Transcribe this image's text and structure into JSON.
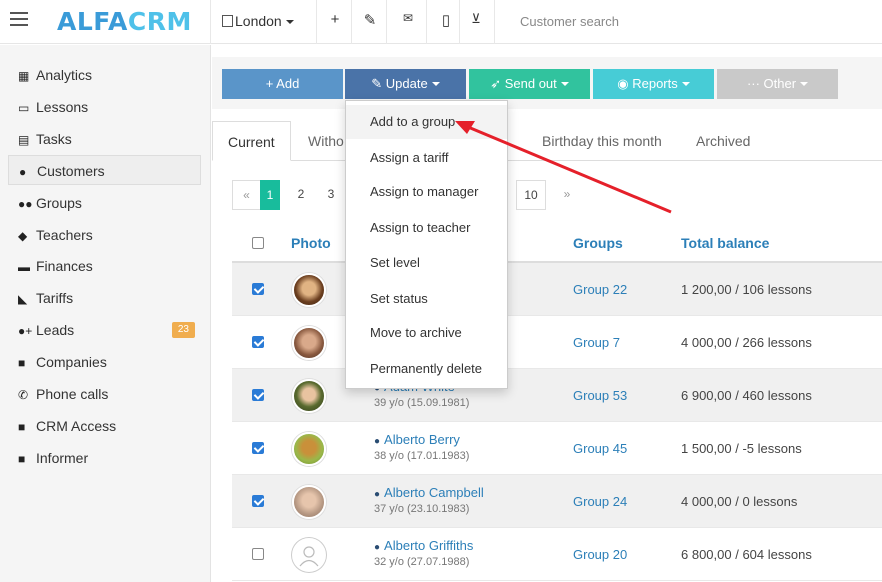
{
  "topbar": {
    "logo_part1": "ALFA",
    "logo_part2": "CRM",
    "branch": "London",
    "search_placeholder": "Customer search"
  },
  "sidebar": {
    "items": [
      {
        "label": "Analytics",
        "icon": "analytics-icon",
        "glyph": "▦"
      },
      {
        "label": "Lessons",
        "icon": "calendar-icon",
        "glyph": "▭"
      },
      {
        "label": "Tasks",
        "icon": "tasks-icon",
        "glyph": "▤"
      },
      {
        "label": "Customers",
        "icon": "user-icon",
        "glyph": "●"
      },
      {
        "label": "Groups",
        "icon": "users-icon",
        "glyph": "●●"
      },
      {
        "label": "Teachers",
        "icon": "graduation-cap-icon",
        "glyph": "◆"
      },
      {
        "label": "Finances",
        "icon": "money-icon",
        "glyph": "▬"
      },
      {
        "label": "Tariffs",
        "icon": "tag-icon",
        "glyph": "◣"
      },
      {
        "label": "Leads",
        "icon": "user-plus-icon",
        "glyph": "●+",
        "badge": "23"
      },
      {
        "label": "Companies",
        "icon": "briefcase-icon",
        "glyph": "■"
      },
      {
        "label": "Phone calls",
        "icon": "phone-icon",
        "glyph": "✆"
      },
      {
        "label": "CRM Access",
        "icon": "lock-icon",
        "glyph": "■"
      },
      {
        "label": "Informer",
        "icon": "book-icon",
        "glyph": "■"
      }
    ]
  },
  "actions": {
    "add": "+ Add",
    "update": "Update",
    "send_out": "Send out",
    "reports": "Reports",
    "other": "Other"
  },
  "tabs": {
    "current": "Current",
    "without": "Witho",
    "birthday": "Birthday this month",
    "archived": "Archived"
  },
  "pager": [
    "«",
    "1",
    "2",
    "3",
    "10",
    "»"
  ],
  "table": {
    "headers": {
      "photo": "Photo",
      "groups": "Groups",
      "balance": "Total balance"
    },
    "rows": [
      {
        "name": "",
        "age": "",
        "group": "Group 22",
        "balance": "1 200,00 / 106 lessons"
      },
      {
        "name": "",
        "age": "",
        "group": "Group 7",
        "balance": "4 000,00 / 266 lessons"
      },
      {
        "name": "Adam White",
        "age": "39 y/o (15.09.1981)",
        "group": "Group 53",
        "balance": "6 900,00 / 460 lessons"
      },
      {
        "name": "Alberto Berry",
        "age": "38 y/o (17.01.1983)",
        "group": "Group 45",
        "balance": "1 500,00 / -5 lessons"
      },
      {
        "name": "Alberto Campbell",
        "age": "37 y/o (23.10.1983)",
        "group": "Group 24",
        "balance": "4 000,00 / 0 lessons"
      },
      {
        "name": "Alberto Griffiths",
        "age": "32 y/o (27.07.1988)",
        "group": "Group 20",
        "balance": "6 800,00 / 604 lessons"
      }
    ]
  },
  "dropdown": {
    "items": [
      "Add to a group",
      "Assign a tariff",
      "Assign to manager",
      "Assign to teacher",
      "Set level",
      "Set status",
      "Move to archive",
      "Permanently delete"
    ]
  },
  "colors": {
    "add": "#5a95c9",
    "update": "#4a73a8",
    "send_out": "#31c39e",
    "reports": "#47ccd6",
    "other": "#c9c9c9",
    "arrow": "#e5202a",
    "accent": "#18bc9c"
  }
}
